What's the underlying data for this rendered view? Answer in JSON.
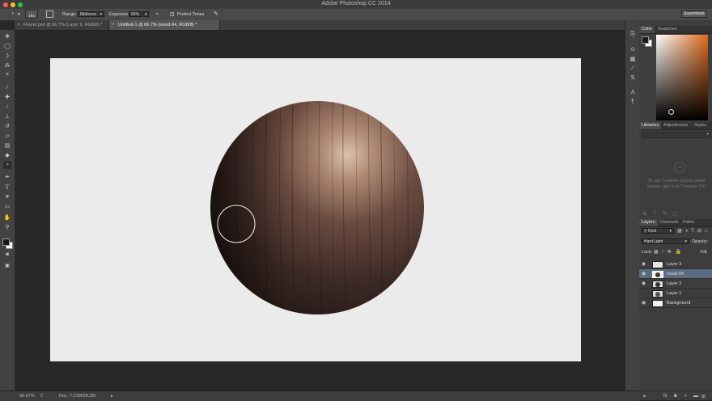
{
  "app": {
    "title": "Adobe Photoshop CC 2014"
  },
  "options_bar": {
    "brush_size": "193",
    "range_label": "Range:",
    "range_value": "Midtones",
    "exposure_label": "Exposure:",
    "exposure_value": "56%",
    "protect_tones_label": "Protect Tones",
    "workspace_button": "Essentials"
  },
  "doc_tabs": [
    {
      "label": "Round.psd @ 66.7% (Layer 9, RGB/8) *",
      "active": false
    },
    {
      "label": "Untitled-1 @ 66.7% (wood-04, RGB/8) *",
      "active": true
    }
  ],
  "status": {
    "zoom": "66.67%",
    "doc_info": "Doc: 7.21M/28.2M"
  },
  "panels": {
    "color_tabs": [
      "Color",
      "Swatches"
    ],
    "library_tabs": [
      "Libraries",
      "Adjustments",
      "Styles"
    ],
    "library_message_line1": "To use Creative Cloud Librari",
    "library_message_line2": "please sign in to Creative Clo",
    "layers_tabs": [
      "Layers",
      "Channels",
      "Paths"
    ],
    "kind_filter": "Kind",
    "blend_mode": "Hard Light",
    "opacity_label": "Opacity:",
    "lock_label": "Lock:",
    "fill_label": "Fill:",
    "layers": [
      {
        "name": "Layer 3",
        "visible": true,
        "selected": false
      },
      {
        "name": "wood-04",
        "visible": true,
        "selected": true
      },
      {
        "name": "Layer 2",
        "visible": true,
        "selected": false
      },
      {
        "name": "Layer 1",
        "visible": false,
        "selected": false
      },
      {
        "name": "Background",
        "visible": true,
        "selected": false
      }
    ]
  },
  "colors": {
    "foreground": "#1a1a1a",
    "background": "#ffffff",
    "picker_hue": "#e06a1c",
    "layer_selected": "#5b6b80"
  },
  "icons": {
    "tools": [
      "move-tool-icon",
      "marquee-tool-icon",
      "lasso-tool-icon",
      "magic-wand-icon",
      "crop-tool-icon",
      "eyedropper-icon",
      "healing-brush-icon",
      "brush-tool-icon",
      "clone-stamp-icon",
      "history-brush-icon",
      "eraser-tool-icon",
      "gradient-tool-icon",
      "dodge-tool-icon",
      "pen-tool-icon",
      "type-tool-icon",
      "path-selection-icon",
      "rectangle-tool-icon",
      "hand-tool-icon",
      "zoom-tool-icon"
    ]
  }
}
